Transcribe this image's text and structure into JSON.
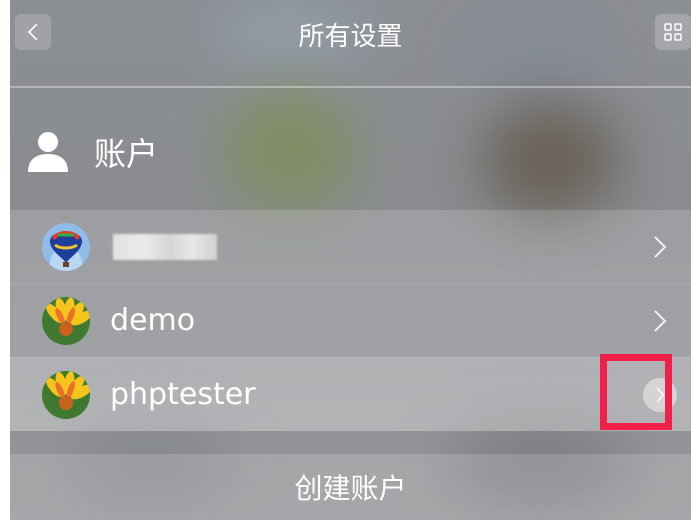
{
  "header": {
    "title": "所有设置",
    "back_icon": "chevron-left-icon",
    "grid_icon": "grid-icon"
  },
  "section": {
    "label": "账户",
    "icon": "user-icon"
  },
  "accounts": [
    {
      "name": "",
      "avatar": "hot-air-balloon-avatar",
      "redacted": true
    },
    {
      "name": "demo",
      "avatar": "flower-avatar"
    },
    {
      "name": "phptester",
      "avatar": "flower-avatar",
      "highlighted": true
    }
  ],
  "actions": {
    "create_account": "创建账户"
  },
  "colors": {
    "highlight": "#f0204a",
    "text": "#ffffff"
  }
}
